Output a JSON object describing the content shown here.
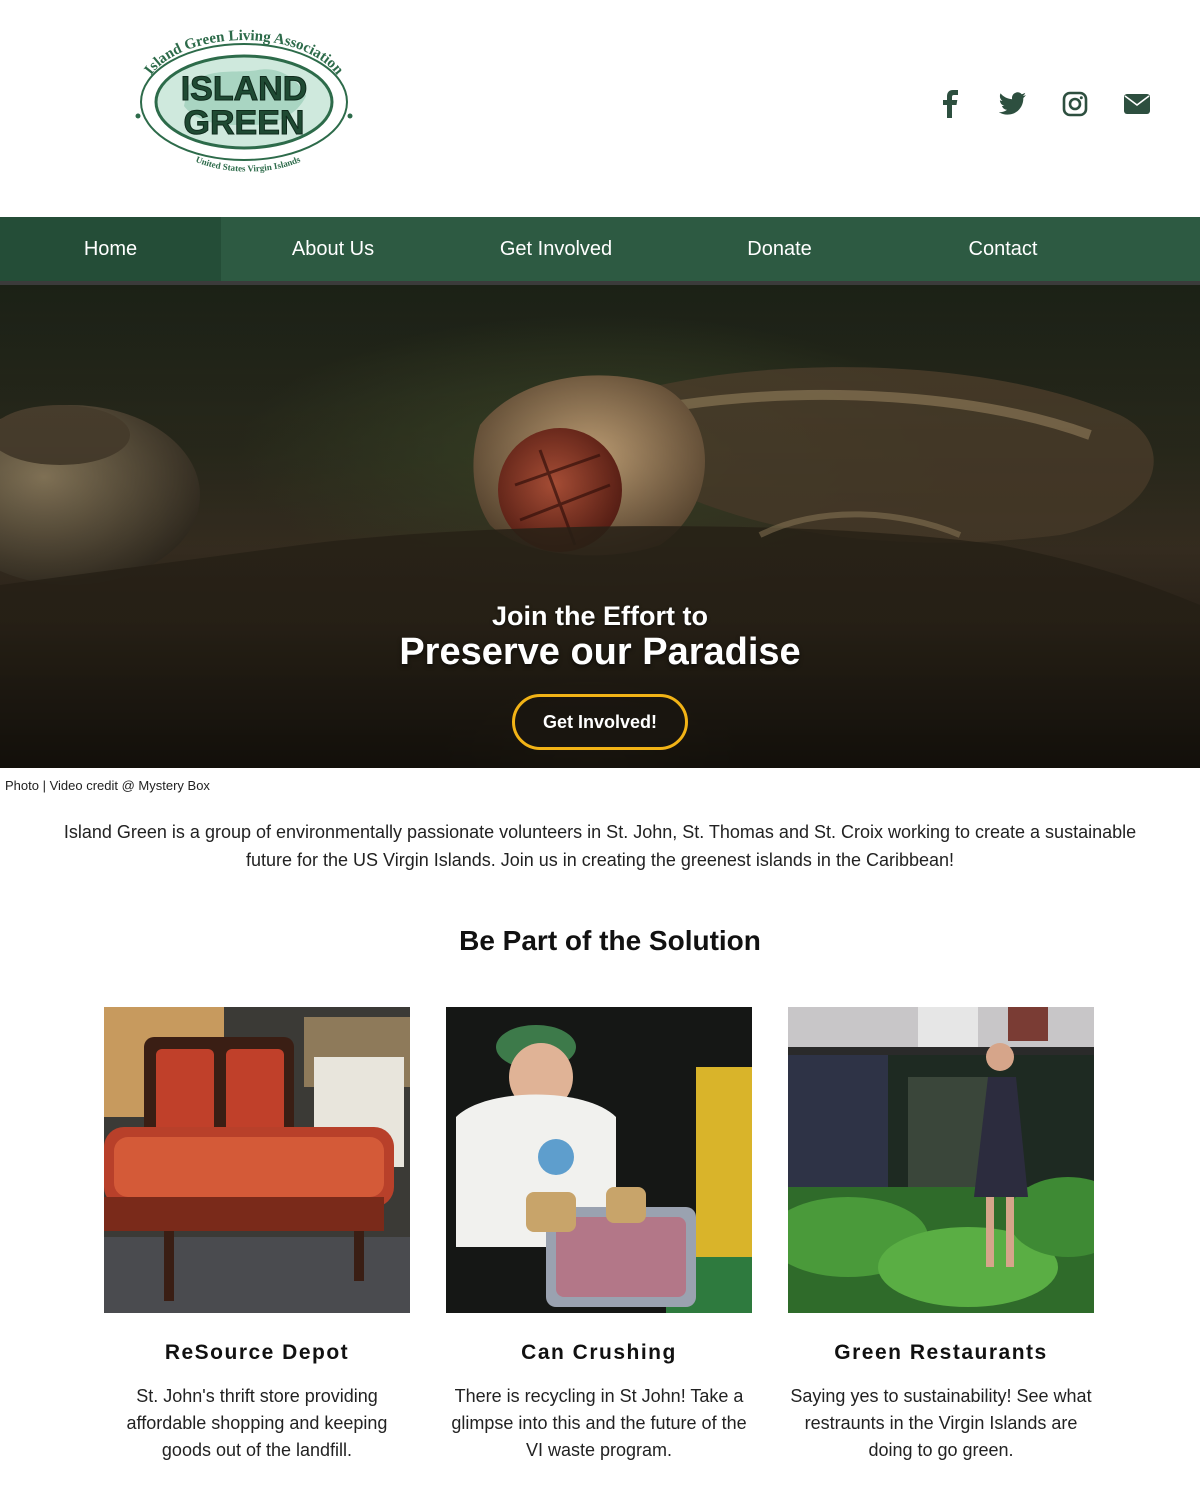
{
  "brand": {
    "logo_top_text": "Island Green Living Association",
    "logo_line1": "ISLAND",
    "logo_line2": "GREEN",
    "logo_bottom_text": "United States Virgin Islands",
    "color_primary": "#2d5a42",
    "color_accent": "#f2b316"
  },
  "social": [
    {
      "icon": "facebook-icon"
    },
    {
      "icon": "twitter-icon"
    },
    {
      "icon": "instagram-icon"
    },
    {
      "icon": "envelope-icon"
    }
  ],
  "nav": {
    "items": [
      {
        "label": "Home",
        "active": true
      },
      {
        "label": "About Us",
        "active": false
      },
      {
        "label": "Get Involved",
        "active": false
      },
      {
        "label": "Donate",
        "active": false
      },
      {
        "label": "Contact",
        "active": false
      }
    ]
  },
  "hero": {
    "subtitle": "Join the Effort to",
    "title": "Preserve our Paradise",
    "button_label": "Get Involved!"
  },
  "credit": "Photo | Video credit @ Mystery Box",
  "intro": "Island Green is a group of environmentally passionate volunteers in St. John, St. Thomas and St. Croix working to create a sustainable future for the US Virgin Islands. Join us in creating the greenest islands in the Caribbean!",
  "solution": {
    "title": "Be Part of the Solution",
    "cards": [
      {
        "title": "ReSource Depot",
        "description": "St. John's thrift store providing affordable shopping and keeping goods out of the landfill."
      },
      {
        "title": "Can Crushing",
        "description": "There is recycling in St John! Take a glimpse into this and the future of the VI waste program."
      },
      {
        "title": "Green Restaurants",
        "description": "Saying yes to sustainability! See what restraunts in the Virgin Islands are doing to go green."
      }
    ]
  }
}
